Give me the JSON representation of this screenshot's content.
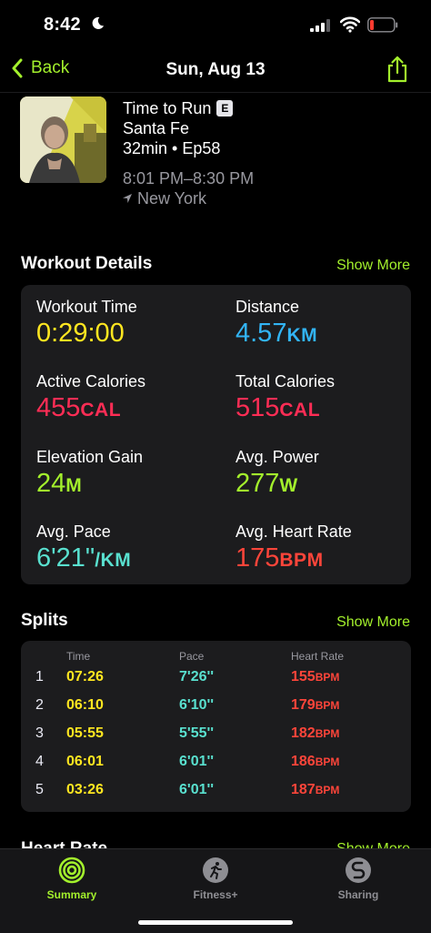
{
  "status_bar": {
    "time": "8:42"
  },
  "nav": {
    "back_label": "Back",
    "title": "Sun, Aug 13"
  },
  "episode": {
    "title": "Time to Run",
    "badge": "E",
    "location_name": "Santa Fe",
    "duration_episode": "32min • Ep58",
    "time_range": "8:01 PM–8:30 PM",
    "city": "New York"
  },
  "workout_details": {
    "title": "Workout Details",
    "show_more": "Show More",
    "items": [
      {
        "label": "Workout Time",
        "value": "0:29:00",
        "unit": "",
        "color": "#ffe620"
      },
      {
        "label": "Distance",
        "value": "4.57",
        "unit": "KM",
        "color": "#32b4f5"
      },
      {
        "label": "Active Calories",
        "value": "455",
        "unit": "CAL",
        "color": "#ff2d55"
      },
      {
        "label": "Total Calories",
        "value": "515",
        "unit": "CAL",
        "color": "#ff2d55"
      },
      {
        "label": "Elevation Gain",
        "value": "24",
        "unit": "M",
        "color": "#a3f02c"
      },
      {
        "label": "Avg. Power",
        "value": "277",
        "unit": "W",
        "color": "#a3f02c"
      },
      {
        "label": "Avg. Pace",
        "value": "6'21\"",
        "unit": "/KM",
        "color": "#59e0cf"
      },
      {
        "label": "Avg. Heart Rate",
        "value": "175",
        "unit": "BPM",
        "color": "#ff453a"
      }
    ]
  },
  "splits": {
    "title": "Splits",
    "show_more": "Show More",
    "columns": [
      "Time",
      "Pace",
      "Heart Rate"
    ],
    "rows": [
      {
        "num": "1",
        "time": "07:26",
        "pace": "7'26''",
        "hr": "155",
        "hr_unit": "BPM"
      },
      {
        "num": "2",
        "time": "06:10",
        "pace": "6'10''",
        "hr": "179",
        "hr_unit": "BPM"
      },
      {
        "num": "3",
        "time": "05:55",
        "pace": "5'55''",
        "hr": "182",
        "hr_unit": "BPM"
      },
      {
        "num": "4",
        "time": "06:01",
        "pace": "6'01''",
        "hr": "186",
        "hr_unit": "BPM"
      },
      {
        "num": "5",
        "time": "03:26",
        "pace": "6'01''",
        "hr": "187",
        "hr_unit": "BPM"
      }
    ]
  },
  "heart_rate_section": {
    "title": "Heart Rate",
    "show_more": "Show More"
  },
  "tabs": [
    {
      "label": "Summary",
      "icon": "activity-rings-icon",
      "active": true
    },
    {
      "label": "Fitness+",
      "icon": "runner-icon",
      "active": false
    },
    {
      "label": "Sharing",
      "icon": "sharing-icon",
      "active": false
    }
  ],
  "colors": {
    "accent": "#a3f02c",
    "background": "#000000",
    "card": "#1c1c1e"
  }
}
